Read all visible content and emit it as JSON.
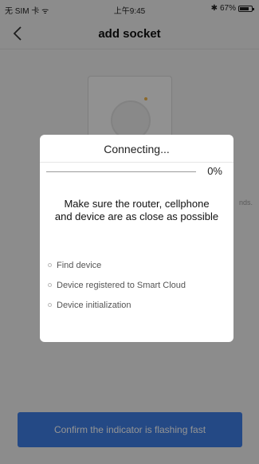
{
  "status_bar": {
    "carrier": "无 SIM 卡 ᯤ",
    "time": "上午9:45",
    "bluetooth": "✱",
    "battery_percent": "67%"
  },
  "nav": {
    "title": "add socket"
  },
  "page": {
    "hint_fragment": "nds.",
    "confirm_button_label": "Confirm the indicator is flashing fast"
  },
  "dialog": {
    "title": "Connecting...",
    "progress_percent": "0%",
    "progress_fraction": 0,
    "message": "Make sure the router, cellphone and device are as close as possible",
    "steps": [
      "Find device",
      "Device registered to Smart Cloud",
      "Device initialization"
    ]
  },
  "colors": {
    "accent": "#3f7fe6",
    "overlay": "rgba(0,0,0,0.42)"
  }
}
